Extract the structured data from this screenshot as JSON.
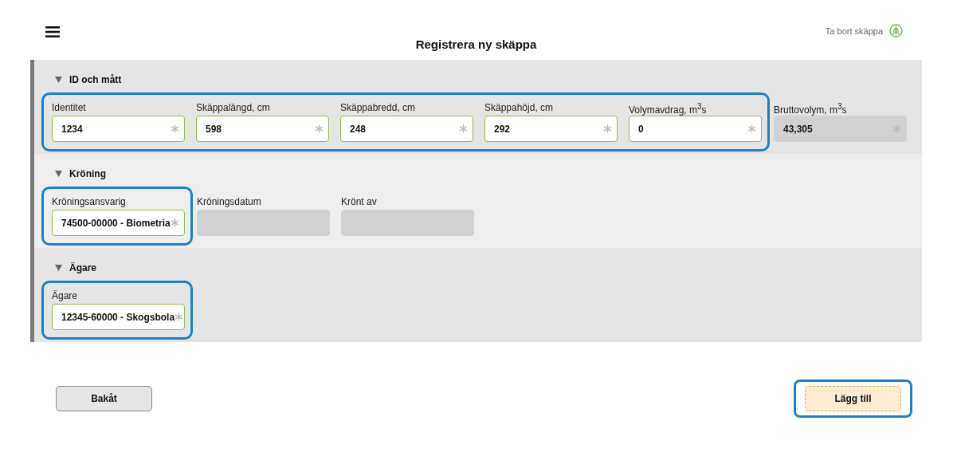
{
  "header": {
    "title": "Registrera ny skäppa",
    "delete_action": "Ta bort skäppa"
  },
  "sections": [
    {
      "title": "ID och mått",
      "expanded": true,
      "groups": [
        {
          "highlighted": true,
          "fields": [
            {
              "label": "Identitet",
              "value": "1234",
              "required": true,
              "disabled": false
            },
            {
              "label": "Skäppalängd, cm",
              "value": "598",
              "required": true,
              "disabled": false
            },
            {
              "label": "Skäppabredd, cm",
              "value": "248",
              "required": true,
              "disabled": false
            },
            {
              "label": "Skäppahöjd, cm",
              "value": "292",
              "required": true,
              "disabled": false
            },
            {
              "label": "Volymavdrag, m$^{3}$s",
              "value": "0",
              "required": true,
              "disabled": false
            }
          ]
        },
        {
          "highlighted": false,
          "fields": [
            {
              "label": "Bruttovolym, m$^{3}$s",
              "value": "43,305",
              "required": true,
              "disabled": true
            }
          ]
        }
      ]
    },
    {
      "title": "Kröning",
      "expanded": true,
      "groups": [
        {
          "highlighted": true,
          "fields": [
            {
              "label": "Kröningsansvarig",
              "value": "74500-00000 - Biometria",
              "required": true,
              "disabled": false
            }
          ]
        },
        {
          "highlighted": false,
          "fields": [
            {
              "label": "Kröningsdatum",
              "required": false,
              "disabled": true
            },
            {
              "label": "Krönt av",
              "required": false,
              "disabled": true
            }
          ]
        }
      ]
    },
    {
      "title": "Ägare",
      "expanded": true,
      "groups": [
        {
          "highlighted": true,
          "fields": [
            {
              "label": "Ägare",
              "value": "12345-60000 - Skogsbola",
              "required": true,
              "disabled": false
            }
          ]
        }
      ]
    }
  ],
  "footer": {
    "back_button": {
      "label": "Bakåt",
      "highlighted": false
    },
    "add_button": {
      "label": "Lägg till",
      "highlighted": true
    }
  }
}
